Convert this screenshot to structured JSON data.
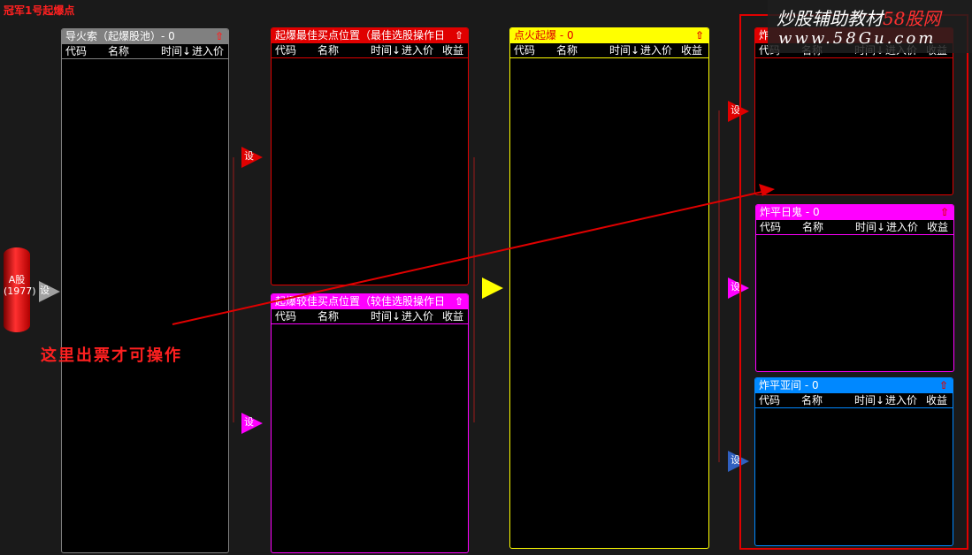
{
  "app_title": "冠军1号起爆点",
  "columns": {
    "code": "代码",
    "name": "名称",
    "time": "时间↓",
    "entry": "进入价",
    "profit": "收益"
  },
  "source": {
    "label": "A股",
    "count": "(1977)"
  },
  "set_label": "设",
  "arrow_up": "⇧",
  "panels": {
    "p1": {
      "title": "导火索（起爆股池）- 0",
      "color": "#808080"
    },
    "p2": {
      "title": "起爆最佳买点位置（最佳选股操作日",
      "color": "#e00000"
    },
    "p3": {
      "title": "起爆较佳买点位置（较佳选股操作日",
      "color": "#ff00ff"
    },
    "p4": {
      "title": "点火起爆 - 0",
      "color": "#ffff00"
    },
    "p5": {
      "title": "炸",
      "color": "#e00000"
    },
    "p6": {
      "title": "炸平日鬼 - 0",
      "color": "#ff00ff"
    },
    "p7": {
      "title": "炸平亚间 - 0",
      "color": "#0088ff"
    }
  },
  "annotation": "这里出票才可操作",
  "watermark": {
    "line1_a": "炒股辅助教材",
    "line1_b": "58股网",
    "line2": "www.58Gu.com"
  }
}
